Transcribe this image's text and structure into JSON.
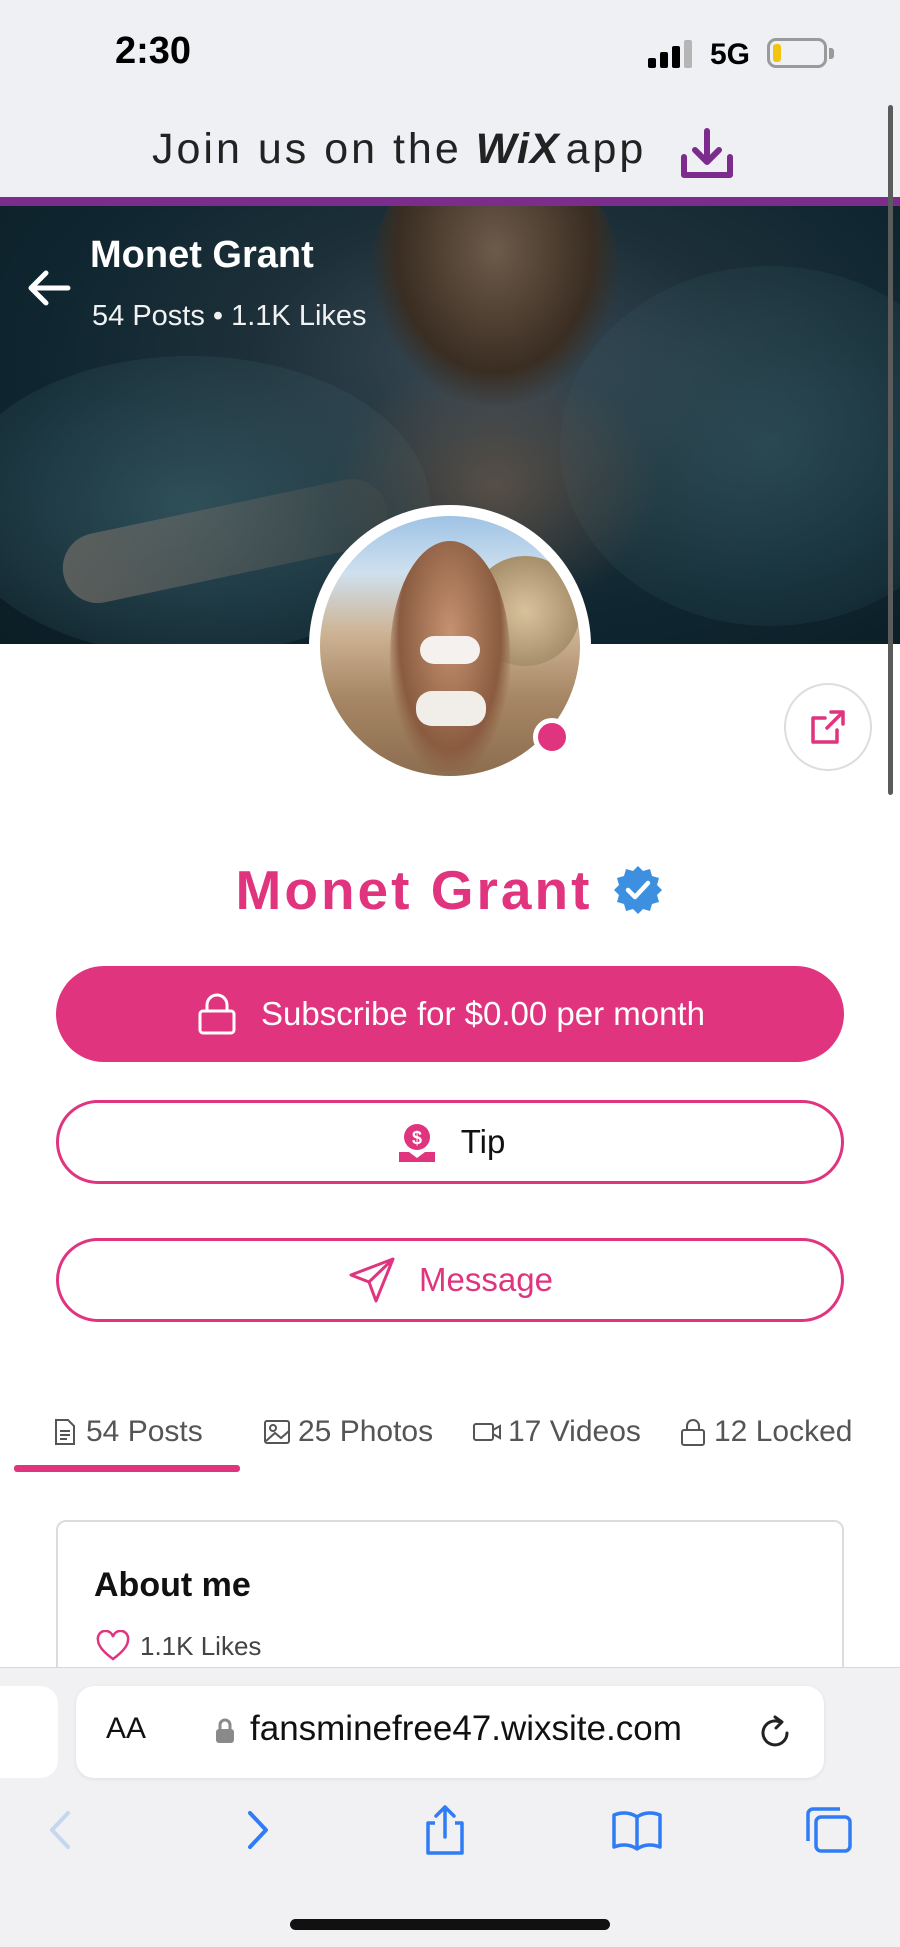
{
  "status_bar": {
    "time": "2:30",
    "network": "5G",
    "battery_level": 0.15
  },
  "wix_banner": {
    "text_prefix": "Join us on the",
    "brand": "WiX",
    "text_suffix": "app",
    "icon": "download-icon"
  },
  "cover": {
    "name": "Monet Grant",
    "stats": "54 Posts • 1.1K Likes",
    "back_icon": "arrow-left-icon"
  },
  "profile": {
    "name": "Monet Grant",
    "verified_icon": "verified-badge-icon",
    "online": true,
    "share_icon": "share-icon"
  },
  "actions": {
    "subscribe": "Subscribe for $0.00 per month",
    "tip": "Tip",
    "message": "Message"
  },
  "tabs": [
    {
      "label": "54 Posts",
      "icon": "document-icon",
      "active": true
    },
    {
      "label": "25 Photos",
      "icon": "image-icon",
      "active": false
    },
    {
      "label": "17 Videos",
      "icon": "video-icon",
      "active": false
    },
    {
      "label": "12 Locked",
      "icon": "lock-icon",
      "active": false
    }
  ],
  "about": {
    "title": "About me",
    "likes": "1.1K Likes"
  },
  "browser": {
    "aa_label": "AA",
    "url": "fansminefree47.wixsite.com"
  },
  "colors": {
    "accent": "#e0347f",
    "wix_purple": "#7b2c8c",
    "verified_blue": "#3d8fe0"
  }
}
